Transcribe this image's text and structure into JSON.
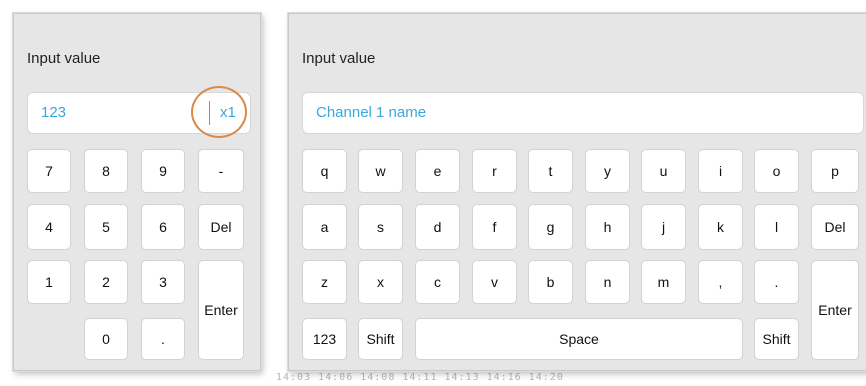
{
  "numpad": {
    "title": "Input value",
    "value": "123",
    "multiplier_label": "x1",
    "highlight_color": "#d88a4a",
    "keys": {
      "k7": "7",
      "k8": "8",
      "k9": "9",
      "minus": "-",
      "k4": "4",
      "k5": "5",
      "k6": "6",
      "del": "Del",
      "k1": "1",
      "k2": "2",
      "k3": "3",
      "enter": "Enter",
      "k0": "0",
      "dot": "."
    }
  },
  "keyboard": {
    "title": "Input value",
    "value": "Channel 1 name",
    "row1": [
      "q",
      "w",
      "e",
      "r",
      "t",
      "y",
      "u",
      "i",
      "o",
      "p"
    ],
    "row2": [
      "a",
      "s",
      "d",
      "f",
      "g",
      "h",
      "j",
      "k",
      "l"
    ],
    "row2_del": "Del",
    "row3": [
      "z",
      "x",
      "c",
      "v",
      "b",
      "n",
      "m",
      ",",
      "."
    ],
    "enter": "Enter",
    "mode_123": "123",
    "shift_left": "Shift",
    "space": "Space",
    "shift_right": "Shift"
  },
  "background": {
    "tick_labels": "14:03   14:06   14:08   14:11   14:13   14:16   14:20"
  },
  "colors": {
    "accent": "#3aa8dc",
    "panel": "#e6e6e6"
  }
}
